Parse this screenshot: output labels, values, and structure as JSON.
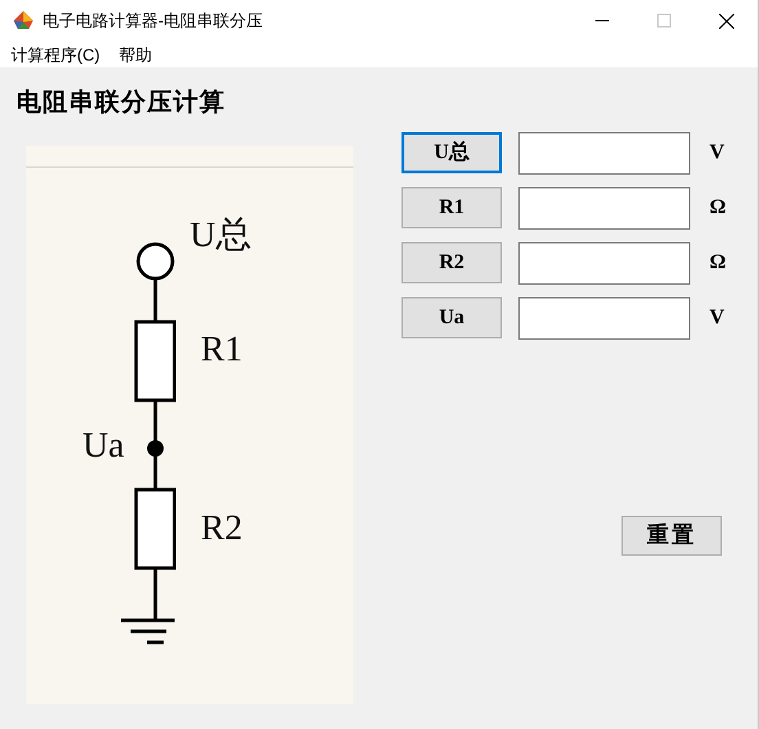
{
  "window": {
    "title": "电子电路计算器-电阻串联分压"
  },
  "menu": [
    "计算程序(C)",
    "帮助"
  ],
  "heading": "电阻串联分压计算",
  "diagram": {
    "labels": [
      {
        "kind": "source",
        "text": "U总"
      },
      {
        "kind": "r1",
        "text": "R1"
      },
      {
        "kind": "node",
        "text": "Ua"
      },
      {
        "kind": "r2",
        "text": "R2"
      }
    ]
  },
  "rows": [
    {
      "button": "U总",
      "focused": true,
      "unit": "V"
    },
    {
      "button": "R1",
      "focused": false,
      "unit": "Ω"
    },
    {
      "button": "R2",
      "focused": false,
      "unit": "Ω"
    },
    {
      "button": "Ua",
      "focused": false,
      "unit": "V"
    }
  ],
  "reset_button": "重置"
}
